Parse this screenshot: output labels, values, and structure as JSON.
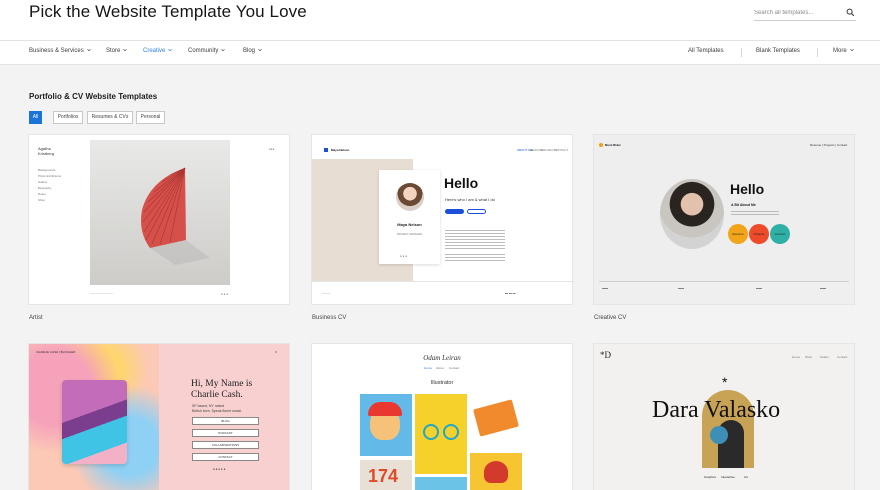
{
  "header": {
    "title": "Pick the Website Template You Love",
    "search_placeholder": "Search all templates..."
  },
  "nav": {
    "left": [
      "Business & Services",
      "Store",
      "Creative",
      "Community",
      "Blog"
    ],
    "right": [
      "All Templates",
      "Blank Templates",
      "More"
    ]
  },
  "section": {
    "title": "Portfolio & CV Website Templates"
  },
  "filters": [
    "All",
    "Portfolios",
    "Resumes & CVs",
    "Personal"
  ],
  "cards": [
    {
      "label": "Artist",
      "name": "Agatha Kristberg",
      "menu": [
        "Backgrounds",
        "Photo Exhibitions",
        "Gallery",
        "Biography",
        "Notes",
        "Shop"
      ]
    },
    {
      "label": "Business CV",
      "brand": "Maya Nelson",
      "nav": [
        "ABOUT ME",
        "RESUME",
        "PROJECTS",
        "CONTACT"
      ],
      "hello": "Hello",
      "sub": "Here's who I am & what I do",
      "person": "Maya Nelson",
      "role": "PROJECT MANAGER"
    },
    {
      "label": "Creative CV",
      "brand": "Nicol Rider",
      "nav": "Resume | Projects | Contact",
      "hello": "Hello",
      "sub": "A Bit About Me",
      "bubbles": [
        "Resume",
        "Projects",
        "Contact"
      ]
    },
    {
      "name_lines": [
        "Hi, My Name is",
        "Charlie Cash."
      ],
      "tag_lines": [
        "SF based, NY raised",
        "British born. Speak fluent social."
      ],
      "buttons": [
        "BLOG",
        "PODCAST",
        "COLLABORATIONS",
        "CONTACT"
      ],
      "brand": "CHARLIE CASH | BLOGGER"
    },
    {
      "brand": "Odam Leiran",
      "nav": [
        "Home",
        "About",
        "Contact"
      ],
      "title": "Illustrator",
      "numeral": "174"
    },
    {
      "logo": "*D",
      "nav": [
        "Home",
        "Work",
        "Studio",
        "Contact"
      ],
      "name": "Dara Valasko",
      "tags": [
        "Graphics",
        "Interactive",
        "Art"
      ]
    }
  ],
  "colors": {
    "accent": "#2f80ed",
    "filter_active": "#1b75d8"
  }
}
